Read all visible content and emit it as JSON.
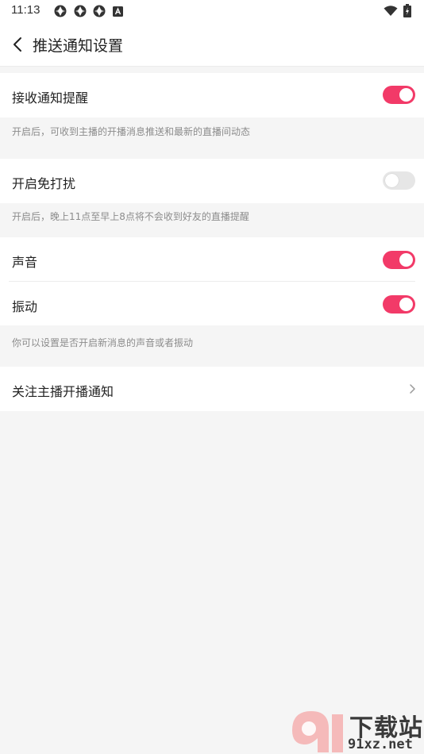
{
  "status_bar": {
    "time": "11:13",
    "icons": [
      "app-icon",
      "app-icon",
      "app-icon",
      "notification-icon",
      "wifi-icon",
      "battery-icon"
    ]
  },
  "header": {
    "title": "推送通知设置",
    "back_icon": "back-arrow-icon"
  },
  "settings": {
    "receive_notify": {
      "label": "接收通知提醒",
      "on": true,
      "hint": "开启后，可收到主播的开播消息推送和最新的直播间动态"
    },
    "dnd": {
      "label": "开启免打扰",
      "on": false,
      "hint": "开启后，晚上11点至早上8点将不会收到好友的直播提醒"
    },
    "sound": {
      "label": "声音",
      "on": true
    },
    "vibrate": {
      "label": "振动",
      "on": true
    },
    "sound_hint": "你可以设置是否开启新消息的声音或者振动",
    "follow_anchor": {
      "label": "关注主播开播通知"
    }
  },
  "colors": {
    "accent": "#f23a68",
    "toggle_off": "#e6e6e6",
    "background": "#f5f5f5",
    "hint_text": "#8c8c8c"
  },
  "watermark": {
    "brand": "下载站",
    "url": "91xz.net"
  }
}
